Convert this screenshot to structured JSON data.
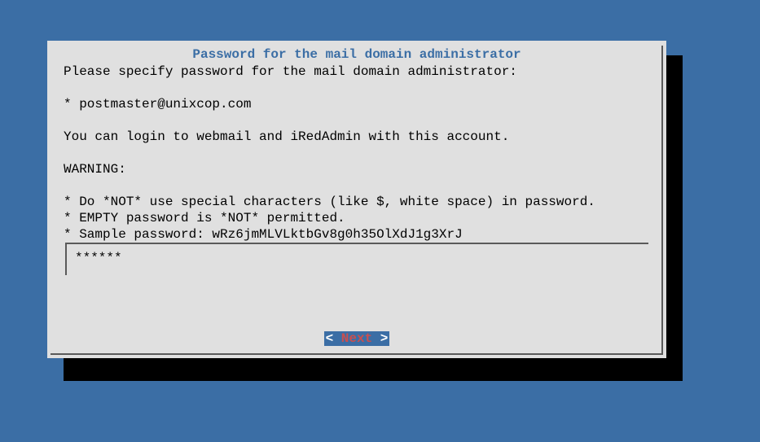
{
  "title": "Password for the mail domain administrator",
  "content": {
    "line1": "Please specify password for the mail domain administrator:",
    "line2": "",
    "line3": "* postmaster@unixcop.com",
    "line4": "",
    "line5": "You can login to webmail and iRedAdmin with this account.",
    "line6": "",
    "line7": "WARNING:",
    "line8": "",
    "line9": "* Do *NOT* use special characters (like $, white space) in password.",
    "line10": "* EMPTY password is *NOT* permitted.",
    "line11": "* Sample password: wRz6jmMLVLktbGv8g0h35OlXdJ1g3XrJ"
  },
  "input": {
    "value": "******"
  },
  "button": {
    "prefix": "< ",
    "hotkey_letter": "N",
    "rest": "ext",
    "suffix": " >"
  }
}
